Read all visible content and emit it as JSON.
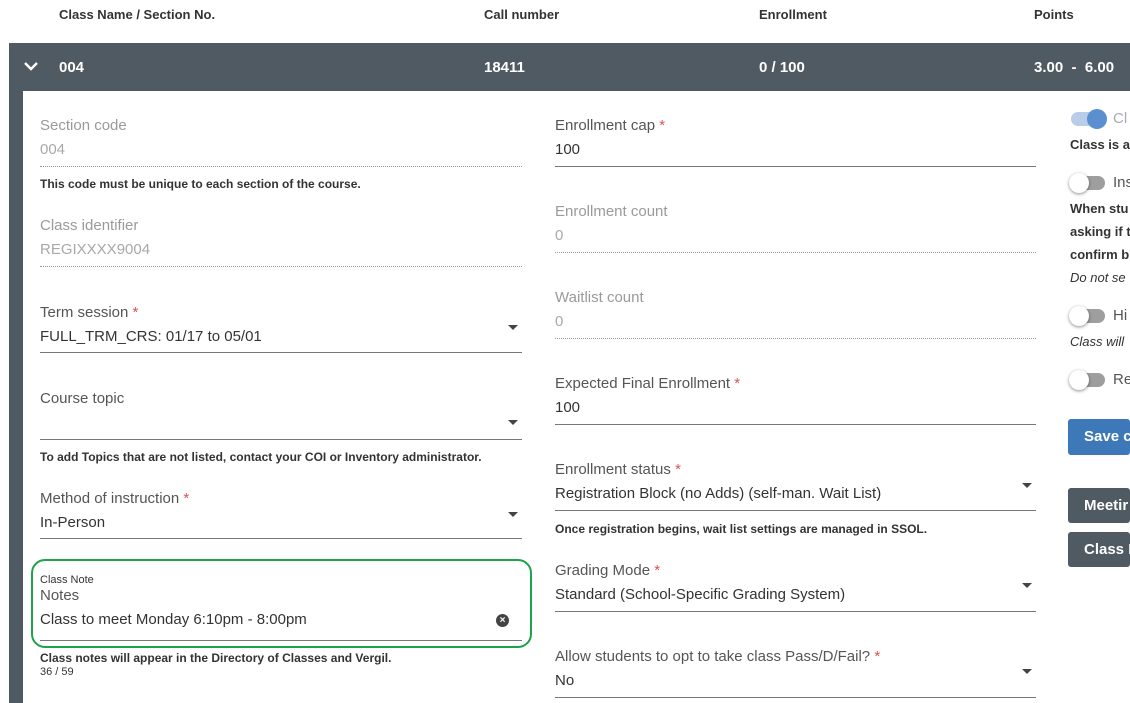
{
  "header": {
    "col_class": "Class Name / Section No.",
    "col_call": "Call number",
    "col_enroll": "Enrollment",
    "col_points": "Points"
  },
  "row": {
    "section": "004",
    "call_number": "18411",
    "enrollment": "0 / 100",
    "points": "3.00  -  6.00"
  },
  "left": {
    "section_code_label": "Section code",
    "section_code_value": "004",
    "section_code_help": "This code must be unique to each section of the course.",
    "class_id_label": "Class identifier",
    "class_id_value": "REGIXXXX9004",
    "term_label": "Term session",
    "term_value": "FULL_TRM_CRS: 01/17 to 05/01",
    "topic_label": "Course topic",
    "topic_value": "",
    "topic_help": "To add Topics that are not listed, contact your COI or Inventory administrator.",
    "method_label": "Method of instruction",
    "method_value": "In-Person",
    "note_small_label": "Class Note",
    "note_label": "Notes",
    "note_value": "Class to meet Monday 6:10pm - 8:00pm",
    "note_help": "Class notes will appear in the Directory of Classes and Vergil.",
    "note_count": "36 / 59"
  },
  "middle": {
    "cap_label": "Enrollment cap",
    "cap_value": "100",
    "count_label": "Enrollment count",
    "count_value": "0",
    "waitlist_label": "Waitlist count",
    "waitlist_value": "0",
    "expected_label": "Expected Final Enrollment",
    "expected_value": "100",
    "status_label": "Enrollment status",
    "status_value": "Registration Block (no Adds) (self-man. Wait List)",
    "status_help": "Once registration begins, wait list settings are managed in SSOL.",
    "grading_label": "Grading Mode",
    "grading_value": "Standard (School-Specific Grading System)",
    "passfail_label": "Allow students to opt to take class Pass/D/Fail?",
    "passfail_value": "No"
  },
  "right": {
    "t1_label": "Cl",
    "t1_text": "Class is a",
    "t2_label": "Ins",
    "t2_text1": "When stu",
    "t2_text2": "asking if t",
    "t2_text3": "confirm b",
    "t2_text4": "Do not se",
    "t3_label": "Hi",
    "t3_text": "Class will",
    "t4_label": "Re",
    "save_label": "Save c",
    "meeting_label": "Meetir",
    "class_btn_label": "Class I"
  },
  "colors": {
    "bar": "#505a63",
    "accent": "#3d79b8",
    "highlight": "#1fa34a",
    "required": "#d9534f"
  },
  "icons": [
    "chevron-down-icon",
    "clear-icon",
    "dropdown-caret-icon"
  ]
}
